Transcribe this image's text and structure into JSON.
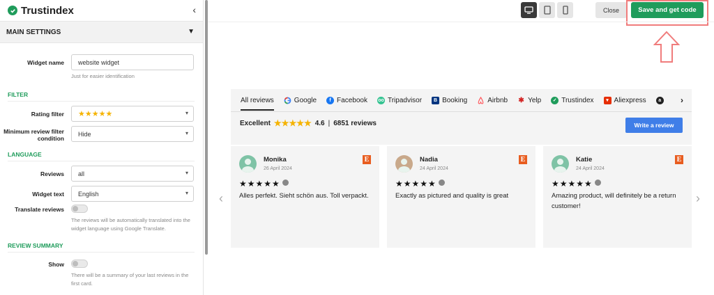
{
  "brand": {
    "name": "Trustindex"
  },
  "sidebar": {
    "main_settings": "MAIN SETTINGS",
    "widget_name_label": "Widget name",
    "widget_name_value": "website widget",
    "widget_name_help": "Just for easier identification",
    "filter_group": "FILTER",
    "rating_filter_label": "Rating filter",
    "rating_filter_value": "★★★★★",
    "min_review_label": "Minimum review filter condition",
    "min_review_value": "Hide",
    "language_group": "LANGUAGE",
    "reviews_label": "Reviews",
    "reviews_value": "all",
    "widget_text_label": "Widget text",
    "widget_text_value": "English",
    "translate_label": "Translate reviews",
    "translate_help": "The reviews will be automatically translated into the widget language using Google Translate.",
    "review_summary_group": "REVIEW SUMMARY",
    "show_label": "Show",
    "show_help": "There will be a summary of your last reviews in the first card."
  },
  "topbar": {
    "close_label": "Close",
    "save_label": "Save and get code"
  },
  "widget": {
    "tabs": [
      {
        "label": "All reviews",
        "icon": "none"
      },
      {
        "label": "Google",
        "icon": "google-icon"
      },
      {
        "label": "Facebook",
        "icon": "facebook-icon"
      },
      {
        "label": "Tripadvisor",
        "icon": "tripadvisor-icon"
      },
      {
        "label": "Booking",
        "icon": "booking-icon"
      },
      {
        "label": "Airbnb",
        "icon": "airbnb-icon"
      },
      {
        "label": "Yelp",
        "icon": "yelp-icon"
      },
      {
        "label": "Trustindex",
        "icon": "trustindex-icon"
      },
      {
        "label": "Aliexpress",
        "icon": "aliexpress-icon"
      }
    ],
    "summary_word": "Excellent",
    "summary_rating": "4.6",
    "summary_sep": "|",
    "summary_count": "6851 reviews",
    "write_label": "Write a review",
    "reviews": [
      {
        "name": "Monika",
        "date": "26 April 2024",
        "text": "Alles perfekt. Sieht schön aus. Toll verpackt."
      },
      {
        "name": "Nadia",
        "date": "24 April 2024",
        "text": "Exactly as pictured and quality is great"
      },
      {
        "name": "Katie",
        "date": "24 April 2024",
        "text": "Amazing product, will definitely be a return customer!"
      }
    ]
  },
  "colors": {
    "accent": "#1f9c5b",
    "button_blue": "#3f7ee8",
    "highlight": "#f07c7c",
    "star": "#f5b301"
  }
}
